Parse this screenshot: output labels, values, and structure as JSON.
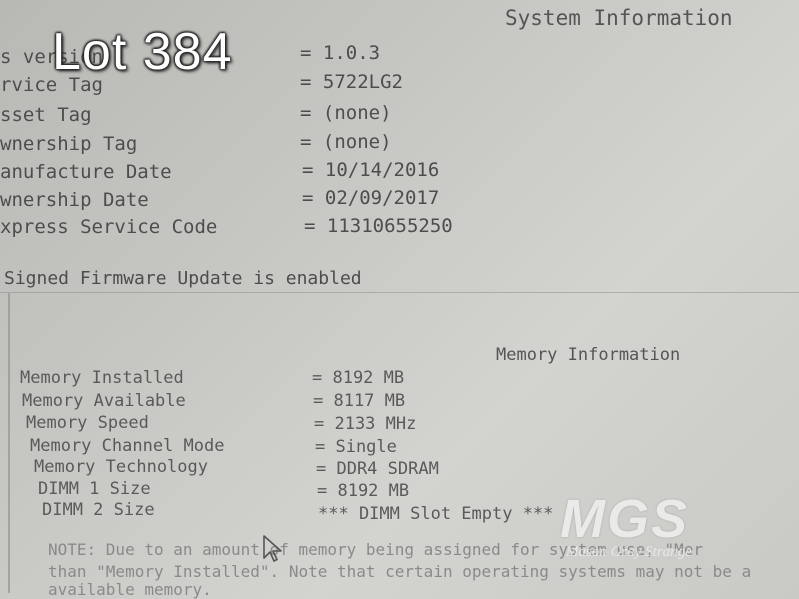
{
  "screen": {
    "title": "System Information"
  },
  "system_info": [
    {
      "label": "s version",
      "value": "= 1.0.3"
    },
    {
      "label": "rvice Tag",
      "value": "= 5722LG2"
    },
    {
      "label": "sset Tag",
      "value": "= (none)"
    },
    {
      "label": "wnership Tag",
      "value": "= (none)"
    },
    {
      "label": "anufacture Date",
      "value": "= 10/14/2016"
    },
    {
      "label": "wnership Date",
      "value": "= 02/09/2017"
    },
    {
      "label": "xpress Service Code",
      "value": "= 11310655250"
    }
  ],
  "firmware_status": "Signed Firmware Update is enabled",
  "memory": {
    "title": "Memory Information",
    "rows": [
      {
        "label": "Memory Installed",
        "value": "= 8192 MB"
      },
      {
        "label": "Memory Available",
        "value": "= 8117 MB"
      },
      {
        "label": "Memory Speed",
        "value": "= 2133 MHz"
      },
      {
        "label": "Memory Channel Mode",
        "value": "= Single"
      },
      {
        "label": "Memory Technology",
        "value": "= DDR4 SDRAM"
      },
      {
        "label": "DIMM 1 Size",
        "value": "= 8192 MB"
      },
      {
        "label": "DIMM 2 Size",
        "value": "*** DIMM Slot Empty ***"
      }
    ],
    "note_lines": [
      "NOTE: Due to an amount of memory being assigned for system use, \"Mer",
      "than \"Memory Installed\". Note that certain operating systems may not be a",
      "available memory."
    ]
  },
  "overlay": {
    "lot_label": "Lot 384",
    "watermark_letters": "MGS",
    "watermark_name": "Mason Gray Strange"
  }
}
